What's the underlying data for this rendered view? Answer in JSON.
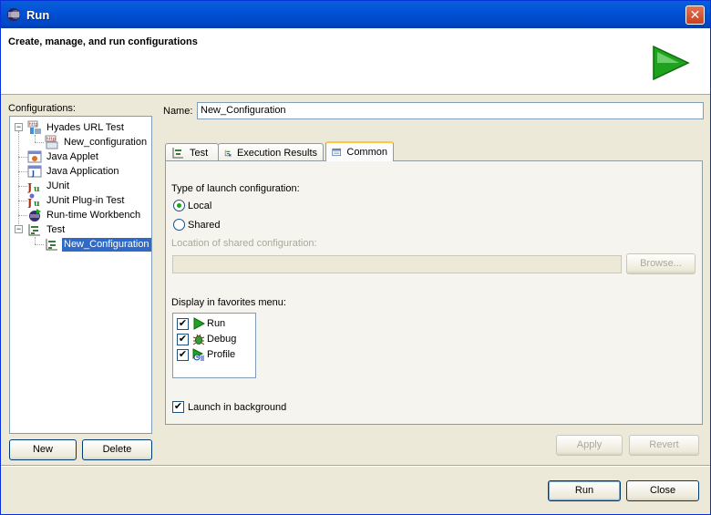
{
  "window": {
    "title": "Run"
  },
  "header": {
    "message": "Create, manage, and run configurations"
  },
  "left": {
    "configurations_label": "Configurations:",
    "tree": [
      {
        "label": "Hyades URL Test",
        "icon": "hyades-url-test-icon"
      },
      {
        "label": "New_configuration",
        "icon": "http-icon"
      },
      {
        "label": "Java Applet",
        "icon": "java-applet-icon"
      },
      {
        "label": "Java Application",
        "icon": "java-application-icon"
      },
      {
        "label": "JUnit",
        "icon": "junit-icon"
      },
      {
        "label": "JUnit Plug-in Test",
        "icon": "junit-plugin-icon"
      },
      {
        "label": "Run-time Workbench",
        "icon": "workbench-icon"
      },
      {
        "label": "Test",
        "icon": "test-icon"
      },
      {
        "label": "New_Configuration",
        "icon": "test-config-icon"
      }
    ],
    "new_button": "New",
    "delete_button": "Delete"
  },
  "right": {
    "name_label": "Name:",
    "name_value": "New_Configuration",
    "tabs": [
      {
        "label": "Test",
        "icon": "test-tab-icon"
      },
      {
        "label": "Execution Results",
        "icon": "execution-results-icon"
      },
      {
        "label": "Common",
        "icon": "common-tab-icon"
      }
    ],
    "common": {
      "launch_type_label": "Type of launch configuration:",
      "local_label": "Local",
      "shared_label": "Shared",
      "location_label": "Location of shared configuration:",
      "location_value": "",
      "browse_button": "Browse...",
      "favorites_label": "Display in favorites menu:",
      "favorites": [
        {
          "label": "Run",
          "checked": true,
          "icon": "run-icon"
        },
        {
          "label": "Debug",
          "checked": true,
          "icon": "debug-icon"
        },
        {
          "label": "Profile",
          "checked": true,
          "icon": "profile-icon"
        }
      ],
      "background_label": "Launch in background",
      "background_checked": true
    },
    "apply_button": "Apply",
    "revert_button": "Revert"
  },
  "footer": {
    "run_button": "Run",
    "close_button": "Close"
  },
  "colors": {
    "accent": "#316ac5",
    "titlebar": "#0052d6",
    "run_green": "#21a121"
  }
}
